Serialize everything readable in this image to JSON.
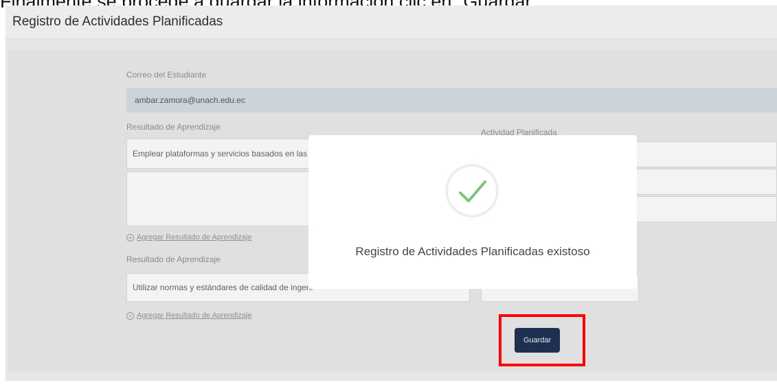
{
  "caption": "Finalmente se procede a guardar la información clic en \"Guardar\"",
  "header": {
    "title": "Registro de Actividades Planificadas"
  },
  "form": {
    "student_email_label": "Correo del Estudiante",
    "student_email_value": "ambar.zamora@unach.edu.ec",
    "learning_result_label_1": "Resultado de Aprendizaje",
    "learning_result_value_1": "Emplear plataformas y servicios basados en las T",
    "planned_activity_label": "Actividad Planificada",
    "add_learning_result_1": "Agregar Resultado de Aprendizaje",
    "learning_result_label_2": "Resultado de Aprendizaje",
    "learning_result_value_2": "Utilizar normas y estándares de calidad de ingeni",
    "add_learning_result_2": "Agregar Resultado de Aprendizaje",
    "save_label": "Guardar"
  },
  "modal": {
    "message": "Registro de Actividades Planificadas existoso",
    "icon": "check-icon",
    "icon_color": "#7cc576"
  },
  "colors": {
    "save_button": "#1e3050",
    "highlight": "#ff0000"
  }
}
